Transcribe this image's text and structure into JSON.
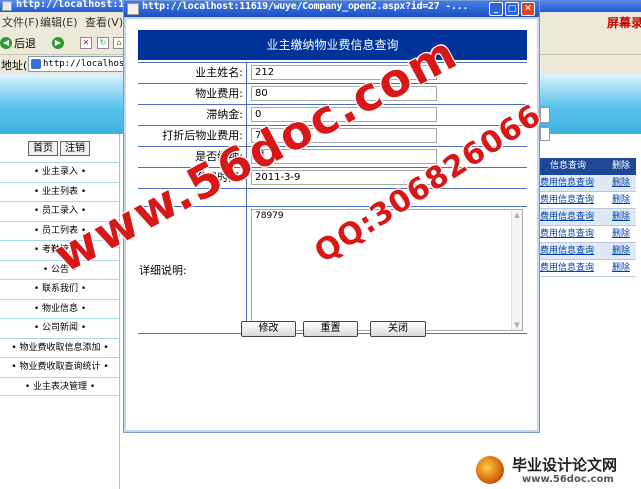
{
  "browser": {
    "title": "http://localhost:11",
    "menu": [
      "文件(F)",
      "编辑(E)",
      "查看(V)"
    ],
    "back_label": "后退",
    "address_label": "地址(D)",
    "address_value": "http://localhost:"
  },
  "site": {
    "header_text": "屏幕录",
    "top_buttons": [
      "首页",
      "注销"
    ],
    "nav_items": [
      "• 业主录入 •",
      "• 业主列表 •",
      "• 员工录入 •",
      "• 员工列表 •",
      "• 考勤管理 •",
      "• 公告 •",
      "• 联系我们 •",
      "• 物业信息 •",
      "• 公司新闻 •",
      "• 物业费收取信息添加 •",
      "• 物业费收取查询统计 •",
      "• 业主表决管理 •"
    ]
  },
  "bg_table": {
    "headers": [
      "信息查询",
      "删除"
    ],
    "rows": [
      [
        "费用信息查询",
        "删除"
      ],
      [
        "费用信息查询",
        "删除"
      ],
      [
        "费用信息查询",
        "删除"
      ],
      [
        "费用信息查询",
        "删除"
      ],
      [
        "费用信息查询",
        "删除"
      ],
      [
        "费用信息查询",
        "删除"
      ]
    ]
  },
  "popup": {
    "title": "http://localhost:11619/wuye/Company_open2.aspx?id=27 -...",
    "header": "业主缴纳物业费信息查询",
    "fields": [
      {
        "label": "业主姓名:",
        "value": "212"
      },
      {
        "label": "物业费用:",
        "value": "80"
      },
      {
        "label": "滞纳金:",
        "value": "0"
      },
      {
        "label": "打折后物业费用:",
        "value": "70"
      },
      {
        "label": "是否缴纳:",
        "value": "是"
      },
      {
        "label": "缴费时间:",
        "value": "2011-3-9"
      }
    ],
    "detail_label": "详细说明:",
    "detail_value": "78979",
    "buttons": {
      "edit": "修改",
      "reset": "重置",
      "close": "关闭"
    }
  },
  "watermark": {
    "site": "www.56doc.com",
    "qq": "QQ:306826066",
    "logo_text": "毕业设计论文网",
    "logo_url": "www.56doc.com"
  },
  "colors": {
    "form_header_bg": "#003399",
    "titlebar": "#2458d4",
    "watermark": "#d81818"
  }
}
